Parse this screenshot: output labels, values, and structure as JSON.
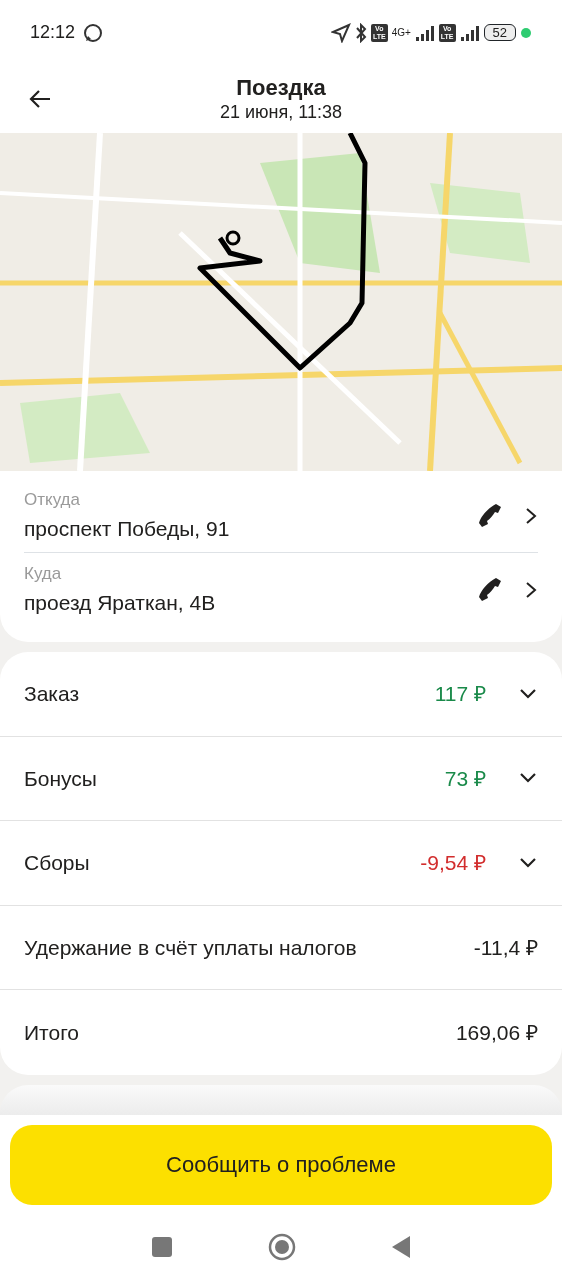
{
  "status_bar": {
    "time": "12:12",
    "network": "4G+",
    "volte_badges": [
      "Vo\nLTE",
      "Vo\nLTE"
    ],
    "battery": "52"
  },
  "header": {
    "title": "Поездка",
    "subtitle": "21 июня, 11:38"
  },
  "route": [
    {
      "label": "Откуда",
      "address": "проспект Победы, 91"
    },
    {
      "label": "Куда",
      "address": "проезд Яраткан, 4В"
    }
  ],
  "summary": [
    {
      "kind": "expandable",
      "label": "Заказ",
      "amount": "117 ₽",
      "color": "#1a8a4a",
      "expanded": false
    },
    {
      "kind": "expandable",
      "label": "Бонусы",
      "amount": "73 ₽",
      "color": "#1a8a4a",
      "expanded": false
    },
    {
      "kind": "expandable",
      "label": "Сборы",
      "amount": "-9,54 ₽",
      "color": "#d22d2d",
      "expanded": false
    },
    {
      "kind": "plain",
      "label": "Удержание в счёт уплаты налогов",
      "amount": "-11,4 ₽",
      "color": "#21201f"
    },
    {
      "kind": "plain",
      "label": "Итого",
      "amount": "169,06 ₽",
      "color": "#21201f"
    }
  ],
  "action_button": "Сообщить о проблеме"
}
